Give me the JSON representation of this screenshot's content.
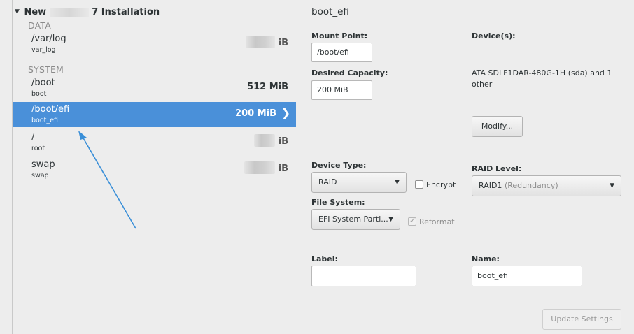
{
  "installation": {
    "prefix": "New",
    "suffix": "7 Installation"
  },
  "groups": [
    {
      "label": "DATA"
    },
    {
      "label": "SYSTEM"
    }
  ],
  "mounts": [
    {
      "name": "/var/log",
      "device": "var_log",
      "size": "iB"
    },
    {
      "name": "/boot",
      "device": "boot",
      "size": "512 MiB"
    },
    {
      "name": "/boot/efi",
      "device": "boot_efi",
      "size": "200 MiB"
    },
    {
      "name": "/",
      "device": "root",
      "size": "iB"
    },
    {
      "name": "swap",
      "device": "swap",
      "size": "iB"
    }
  ],
  "detail": {
    "title": "boot_efi",
    "mount_point_label": "Mount Point:",
    "mount_point_value": "/boot/efi",
    "desired_capacity_label": "Desired Capacity:",
    "desired_capacity_value": "200 MiB",
    "devices_label": "Device(s):",
    "devices_value": "ATA SDLF1DAR-480G-1H (sda) and 1 other",
    "modify_label": "Modify...",
    "device_type_label": "Device Type:",
    "device_type_value": "RAID",
    "encrypt_label": "Encrypt",
    "raid_level_label": "RAID Level:",
    "raid_level_value": "RAID1",
    "raid_level_note": "(Redundancy)",
    "file_system_label": "File System:",
    "file_system_value": "EFI System Parti...",
    "reformat_label": "Reformat",
    "label_label": "Label:",
    "label_value": "",
    "name_label": "Name:",
    "name_value": "boot_efi",
    "update_label": "Update Settings"
  },
  "colors": {
    "selection": "#4a90d9",
    "arrow": "#3a8fd8"
  }
}
